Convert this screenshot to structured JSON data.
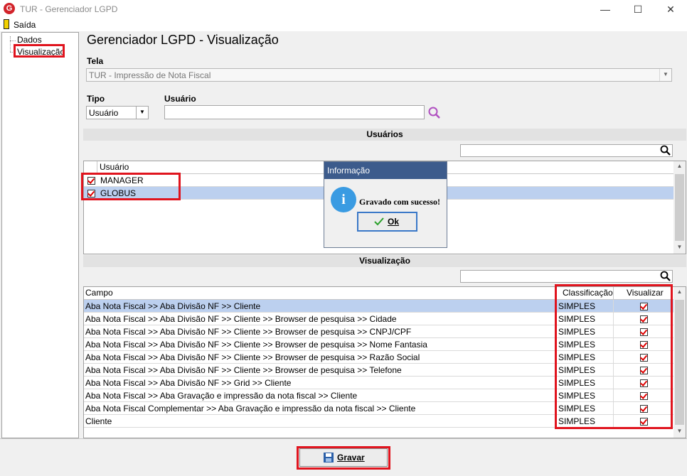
{
  "window": {
    "title": "TUR - Gerenciador LGPD",
    "logo_letter": "G"
  },
  "menu": {
    "exit_label": "Saída"
  },
  "tree": {
    "items": [
      "Dados",
      "Visualização"
    ]
  },
  "page": {
    "heading": "Gerenciador LGPD - Visualização"
  },
  "tela": {
    "label": "Tela",
    "value": "TUR - Impressão de Nota Fiscal"
  },
  "tipo": {
    "label": "Tipo",
    "value": "Usuário"
  },
  "usuario": {
    "label": "Usuário",
    "value": ""
  },
  "users_section": {
    "title": "Usuários",
    "column": "Usuário",
    "rows": [
      {
        "name": "MANAGER",
        "checked": true,
        "selected": false
      },
      {
        "name": "GLOBUS",
        "checked": true,
        "selected": true
      }
    ]
  },
  "view_section": {
    "title": "Visualização",
    "columns": {
      "campo": "Campo",
      "classificacao": "Classificação",
      "visualizar": "Visualizar"
    },
    "rows": [
      {
        "campo": "Aba Nota Fiscal >> Aba Divisão NF >> Cliente",
        "classificacao": "SIMPLES",
        "visualizar": true,
        "selected": true
      },
      {
        "campo": "Aba Nota Fiscal >> Aba Divisão NF >> Cliente >> Browser de pesquisa >> Cidade",
        "classificacao": "SIMPLES",
        "visualizar": true
      },
      {
        "campo": "Aba Nota Fiscal >> Aba Divisão NF >> Cliente >> Browser de pesquisa >> CNPJ/CPF",
        "classificacao": "SIMPLES",
        "visualizar": true
      },
      {
        "campo": "Aba Nota Fiscal >> Aba Divisão NF >> Cliente >> Browser de pesquisa >> Nome Fantasia",
        "classificacao": "SIMPLES",
        "visualizar": true
      },
      {
        "campo": "Aba Nota Fiscal >> Aba Divisão NF >> Cliente >> Browser de pesquisa >> Razão Social",
        "classificacao": "SIMPLES",
        "visualizar": true
      },
      {
        "campo": "Aba Nota Fiscal >> Aba Divisão NF >> Cliente >> Browser de pesquisa >> Telefone",
        "classificacao": "SIMPLES",
        "visualizar": true
      },
      {
        "campo": "Aba Nota Fiscal >> Aba Divisão NF >> Grid >> Cliente",
        "classificacao": "SIMPLES",
        "visualizar": true
      },
      {
        "campo": "Aba Nota Fiscal >> Aba Gravação e impressão da nota fiscal >> Cliente",
        "classificacao": "SIMPLES",
        "visualizar": true
      },
      {
        "campo": "Aba Nota Fiscal Complementar >> Aba Gravação e impressão da nota fiscal >> Cliente",
        "classificacao": "SIMPLES",
        "visualizar": true
      },
      {
        "campo": "Cliente",
        "classificacao": "SIMPLES",
        "visualizar": true
      }
    ]
  },
  "dialog": {
    "title": "Informação",
    "message": "Gravado com sucesso!",
    "ok_label": "Ok"
  },
  "footer": {
    "save_label": "Gravar"
  },
  "colors": {
    "highlight": "#e0141e",
    "selection": "#bcd0ef",
    "dialog_title": "#3c5b8c",
    "info_icon": "#3a9be2"
  }
}
